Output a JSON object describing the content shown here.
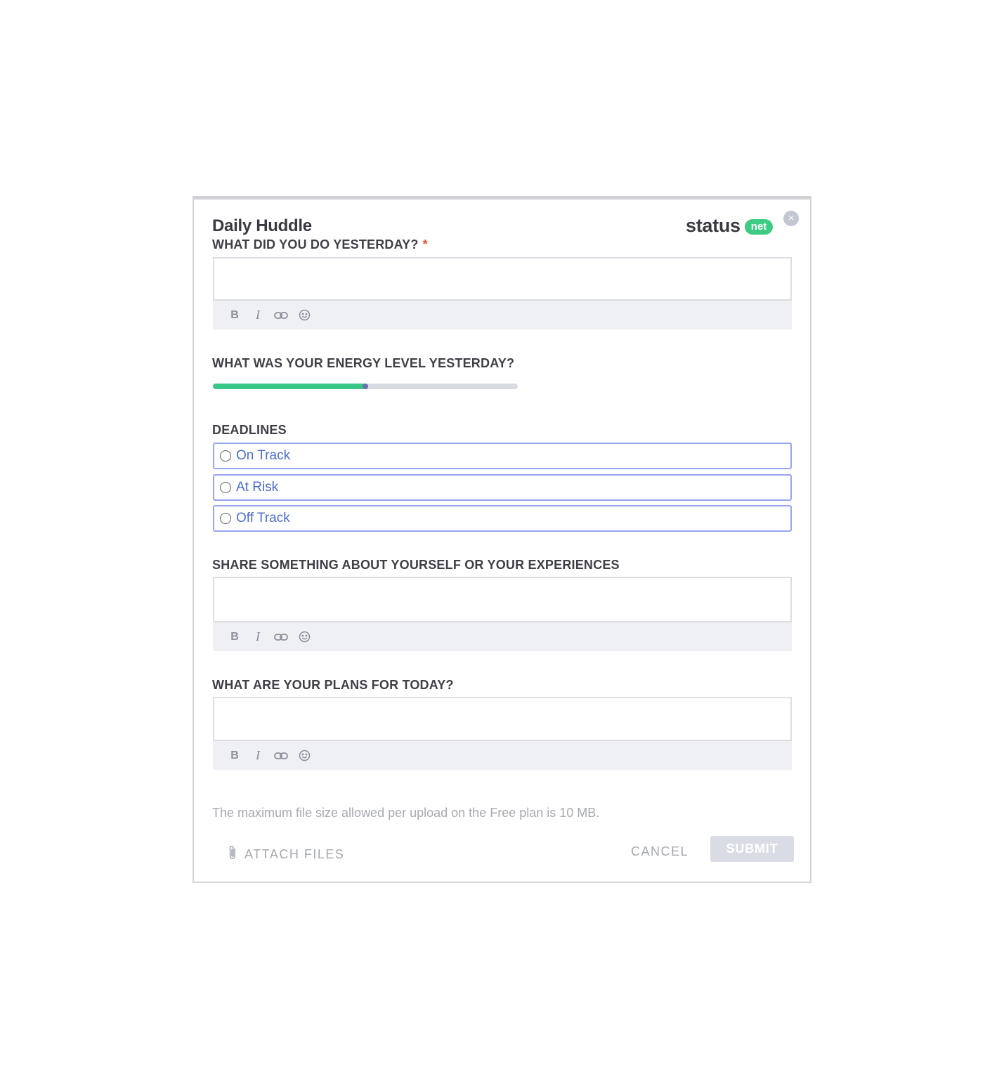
{
  "header": {
    "title": "Daily Huddle",
    "logo_word": "status",
    "logo_badge": "net",
    "close_label": "×"
  },
  "fields": {
    "yesterday": {
      "label": "WHAT DID YOU DO YESTERDAY?",
      "required_mark": "*",
      "value": "",
      "placeholder": ""
    },
    "energy": {
      "label": "WHAT WAS YOUR ENERGY LEVEL YESTERDAY?",
      "level_fraction": 0.5
    },
    "deadlines": {
      "label": "DEADLINES",
      "options": [
        {
          "label": "On Track",
          "selected": false
        },
        {
          "label": "At Risk",
          "selected": false
        },
        {
          "label": "Off Track",
          "selected": false
        }
      ]
    },
    "share": {
      "label": "SHARE SOMETHING ABOUT YOURSELF OR YOUR EXPERIENCES",
      "value": "",
      "placeholder": ""
    },
    "plans": {
      "label": "WHAT ARE YOUR PLANS FOR TODAY?",
      "value": "",
      "placeholder": ""
    }
  },
  "toolbar": {
    "bold_label": "B",
    "italic_label": "I",
    "icons": [
      "bold-icon",
      "italic-icon",
      "link-icon",
      "emoji-icon"
    ]
  },
  "footer": {
    "upload_note": "The maximum file size allowed per upload on the Free plan is 10 MB.",
    "attach_label": "ATTACH FILES",
    "cancel_label": "CANCEL",
    "submit_label": "SUBMIT"
  },
  "colors": {
    "brand_green": "#3ecb84",
    "radio_border": "#98a6ee",
    "radio_text": "#4a6ec9",
    "required": "#e8542f",
    "submit_disabled": "#d9dce5"
  }
}
